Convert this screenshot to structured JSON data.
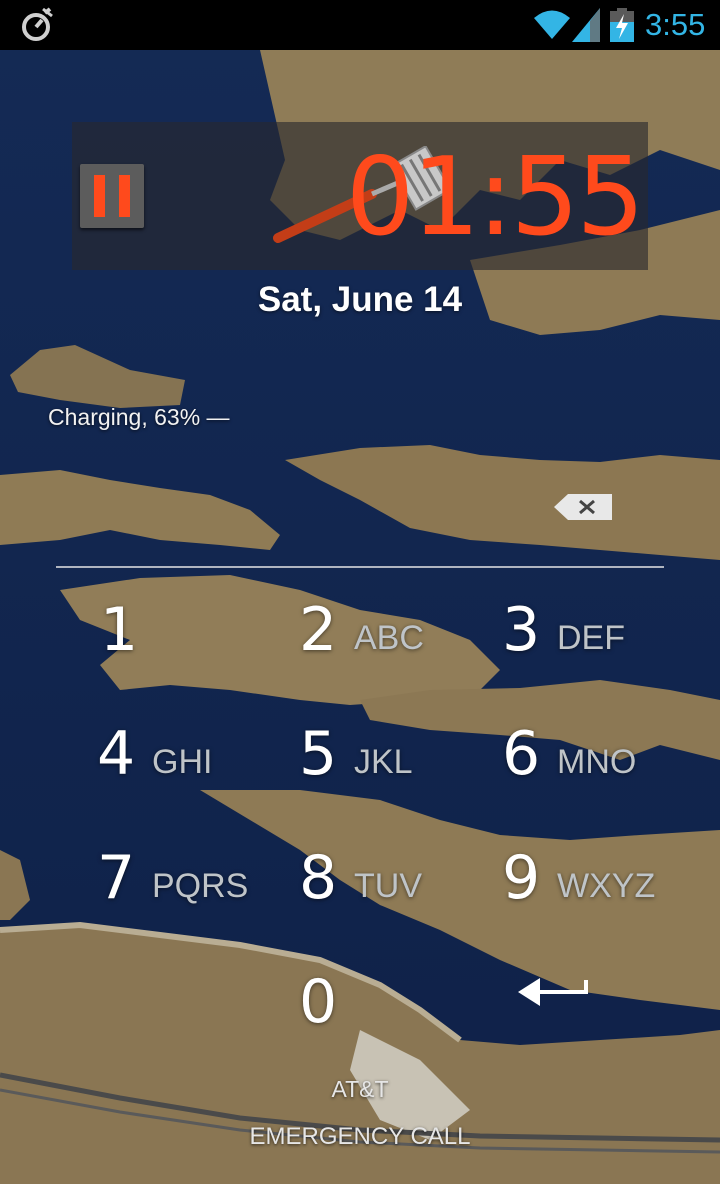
{
  "status_bar": {
    "time": "3:55",
    "left_icon": "stopwatch-icon",
    "icons": [
      "wifi-icon",
      "signal-icon",
      "battery-charging-icon"
    ],
    "time_color": "#33b5e5"
  },
  "timer_widget": {
    "time": "01:55",
    "pause_icon": "pause-icon",
    "decor_icon": "spatula-icon",
    "accent_color": "#ff4a1c"
  },
  "lockscreen": {
    "date": "Sat, June 14",
    "charging": "Charging, 63% —"
  },
  "keypad": {
    "delete_icon": "backspace-icon",
    "enter_icon": "enter-arrow-icon",
    "keys": [
      {
        "num": "1",
        "letters": ""
      },
      {
        "num": "2",
        "letters": "ABC"
      },
      {
        "num": "3",
        "letters": "DEF"
      },
      {
        "num": "4",
        "letters": "GHI"
      },
      {
        "num": "5",
        "letters": "JKL"
      },
      {
        "num": "6",
        "letters": "MNO"
      },
      {
        "num": "7",
        "letters": "PQRS"
      },
      {
        "num": "8",
        "letters": "TUV"
      },
      {
        "num": "9",
        "letters": "WXYZ"
      },
      {
        "num": "0",
        "letters": ""
      }
    ]
  },
  "footer": {
    "carrier": "AT&T",
    "emergency": "EMERGENCY CALL"
  }
}
